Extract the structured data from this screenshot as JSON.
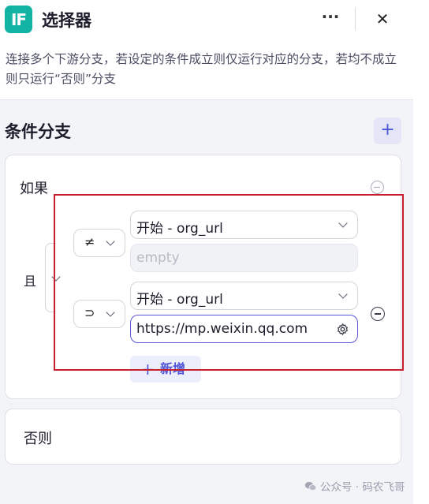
{
  "header": {
    "app_icon_text": "IF",
    "title": "选择器",
    "more_label": "···",
    "close_label": "✕",
    "description": "连接多个下游分支，若设定的条件成立则仅运行对应的分支，若均不成立则只运行“否则”分支"
  },
  "branches": {
    "section_title": "条件分支",
    "add_branch_label": "+"
  },
  "if_block": {
    "label": "如果",
    "logic_operator": "且",
    "conditions": [
      {
        "operator": "≠",
        "left_value": "开始 - org_url",
        "right_placeholder": "empty"
      },
      {
        "operator": "⊃",
        "left_value": "开始 - org_url",
        "right_value": "https://mp.weixin.qq.com"
      }
    ],
    "add_condition_plus": "+",
    "add_condition_label": "新增"
  },
  "else_block": {
    "label": "否则"
  },
  "watermark": {
    "text": "公众号 · 码农飞哥"
  },
  "colors": {
    "accent": "#4e55d6",
    "app_icon": "#12b3a2",
    "highlight": "#c8202f"
  }
}
